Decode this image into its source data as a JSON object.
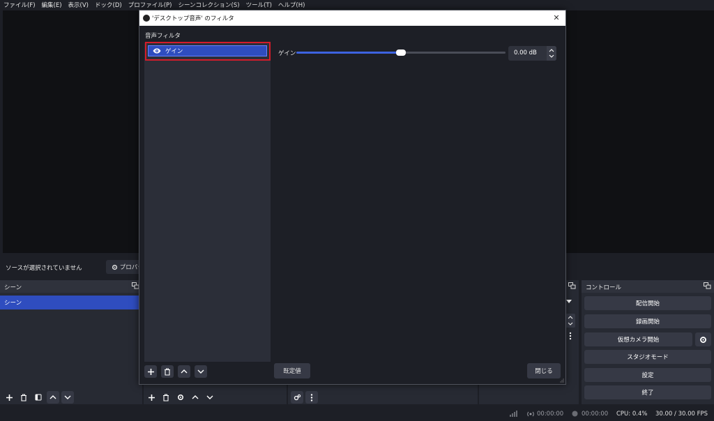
{
  "menu": [
    "ファイル(F)",
    "編集(E)",
    "表示(V)",
    "ドック(D)",
    "プロファイル(P)",
    "シーンコレクション(S)",
    "ツール(T)",
    "ヘルプ(H)"
  ],
  "source_bar": {
    "message": "ソースが選択されていません",
    "properties_label": "プロパテ"
  },
  "scenes": {
    "title": "シーン",
    "items": [
      "シーン"
    ]
  },
  "controls": {
    "title": "コントロール",
    "start_stream": "配信開始",
    "start_record": "録画開始",
    "virtual_camera": "仮想カメラ開始",
    "studio_mode": "スタジオモード",
    "settings": "設定",
    "exit": "終了"
  },
  "status": {
    "stream_time": "00:00:00",
    "record_time": "00:00:00",
    "cpu": "CPU: 0.4%",
    "fps": "30.00 / 30.00 FPS"
  },
  "dialog": {
    "title": "'デスクトップ音声' のフィルタ",
    "section_label": "音声フィルタ",
    "filters": [
      {
        "name": "ゲイン"
      }
    ],
    "gain_label": "ゲイン",
    "gain_value": "0.00 dB",
    "slider_fraction": 0.5,
    "defaults_button": "既定値",
    "close_button": "閉じる"
  },
  "colors": {
    "accent": "#2f4dbf",
    "highlight_box": "#d51c2a",
    "slider_fill": "#3d63e0"
  }
}
